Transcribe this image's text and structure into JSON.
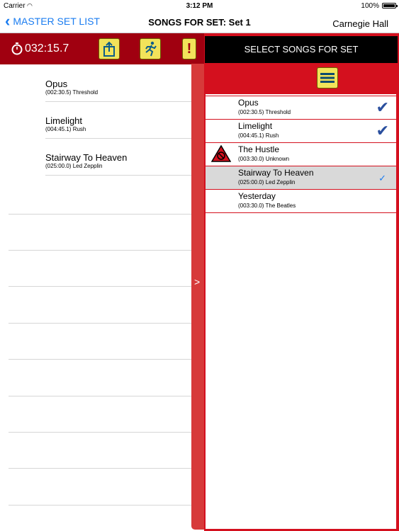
{
  "status_bar": {
    "carrier": "Carrier",
    "time": "3:12 PM",
    "battery": "100%"
  },
  "nav": {
    "back_label": "MASTER SET LIST",
    "title": "SONGS FOR SET: Set 1",
    "right_label": "Carnegie Hall"
  },
  "toolbar": {
    "timer": "032:15.7"
  },
  "set_songs": [
    {
      "title": "Opus",
      "detail": "(002:30.5) Threshold"
    },
    {
      "title": "Limelight",
      "detail": "(004:45.1) Rush"
    },
    {
      "title": "Stairway To Heaven",
      "detail": "(025:00.0) Led Zepplin"
    }
  ],
  "panel": {
    "header": "SELECT SONGS FOR SET",
    "handle_label": ">",
    "songs": [
      {
        "title": "Opus",
        "detail": "(002:30.5) Threshold",
        "checked": true
      },
      {
        "title": "Limelight",
        "detail": "(004:45.1) Rush",
        "checked": true
      },
      {
        "title": "The Hustle",
        "detail": "(003:30.0) Unknown",
        "checked": false,
        "warning": true
      },
      {
        "title": "Stairway To Heaven",
        "detail": "(025:00.0) Led Zepplin",
        "checked": true,
        "selected": true
      },
      {
        "title": "Yesterday",
        "detail": "(003:30.0) The Beatles",
        "checked": false
      }
    ]
  },
  "colors": {
    "accent": "#1a7cf0",
    "brand_red": "#a00010",
    "panel_red": "#d4101e",
    "button_yellow": "#f2e35a"
  }
}
